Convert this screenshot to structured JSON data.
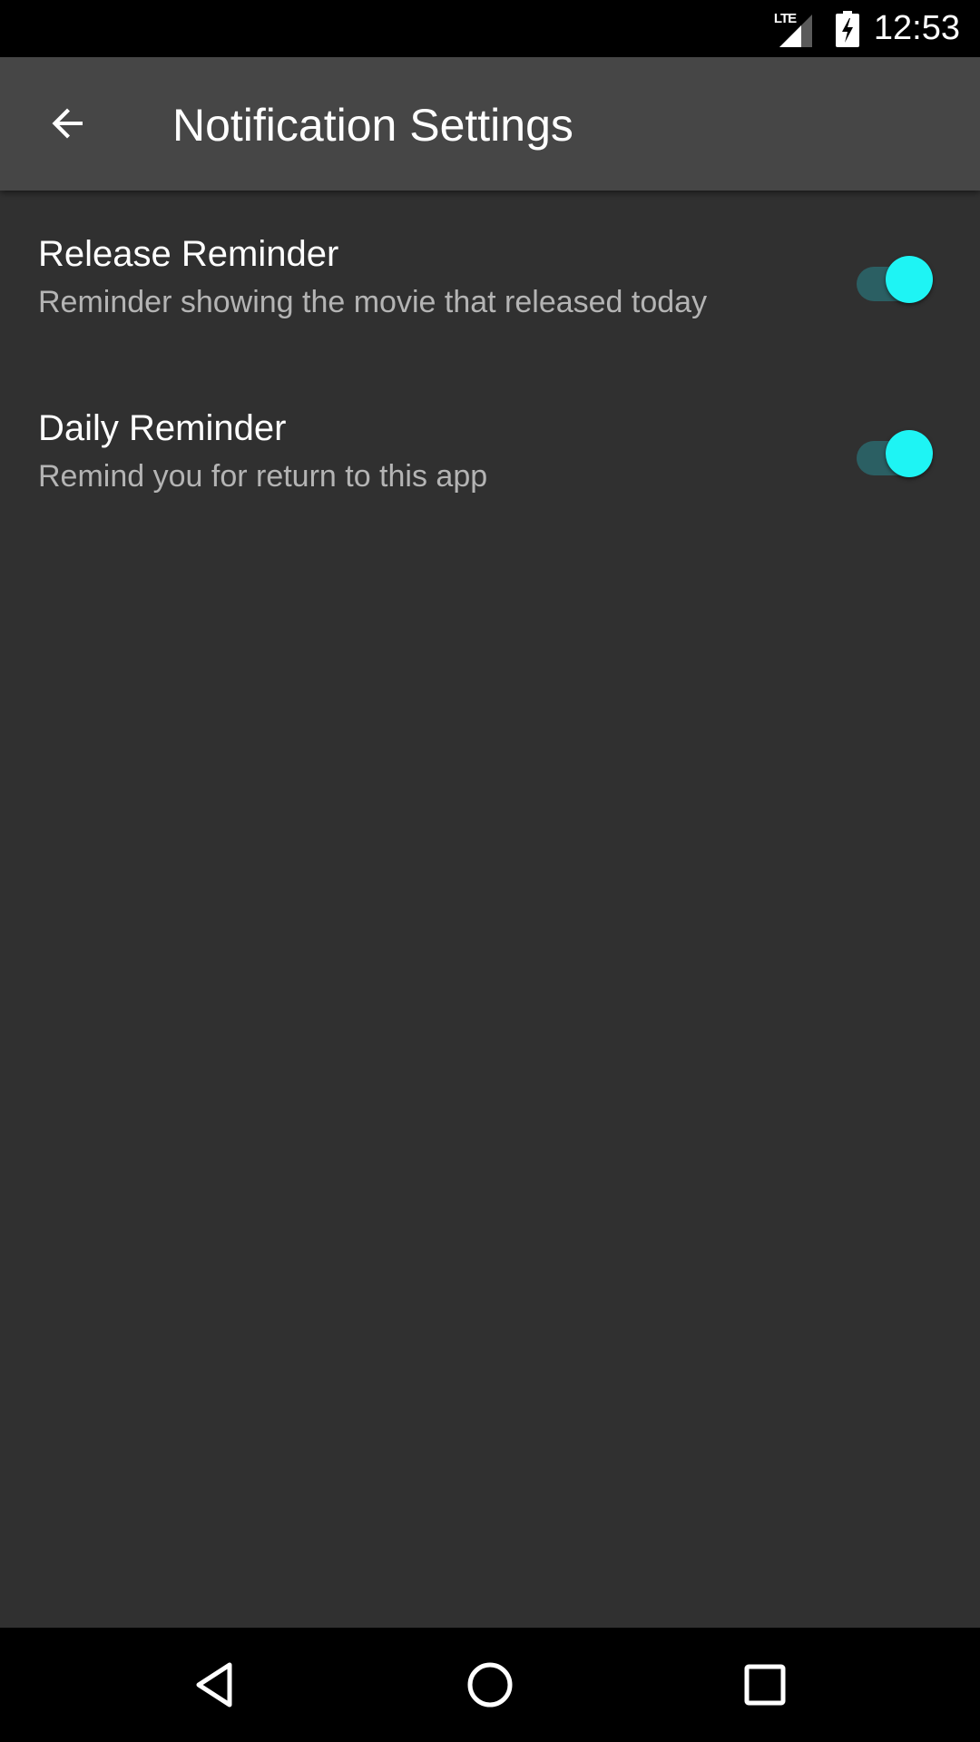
{
  "status_bar": {
    "network_label": "LTE",
    "time": "12:53",
    "icons": [
      "lte-signal-icon",
      "battery-charging-icon"
    ]
  },
  "app_bar": {
    "title": "Notification Settings",
    "back_icon": "arrow-back-icon"
  },
  "settings": [
    {
      "title": "Release Reminder",
      "summary": "Reminder showing the movie that released today",
      "enabled": true
    },
    {
      "title": "Daily Reminder",
      "summary": "Remind you for return to this app",
      "enabled": true
    }
  ],
  "nav_bar": {
    "icons": [
      "nav-back-icon",
      "nav-home-icon",
      "nav-recents-icon"
    ]
  },
  "colors": {
    "background": "#303030",
    "app_bar": "#464646",
    "accent": "#1ef4f4",
    "switch_track": "#2b5f63",
    "summary_text": "#b4b4b4"
  }
}
